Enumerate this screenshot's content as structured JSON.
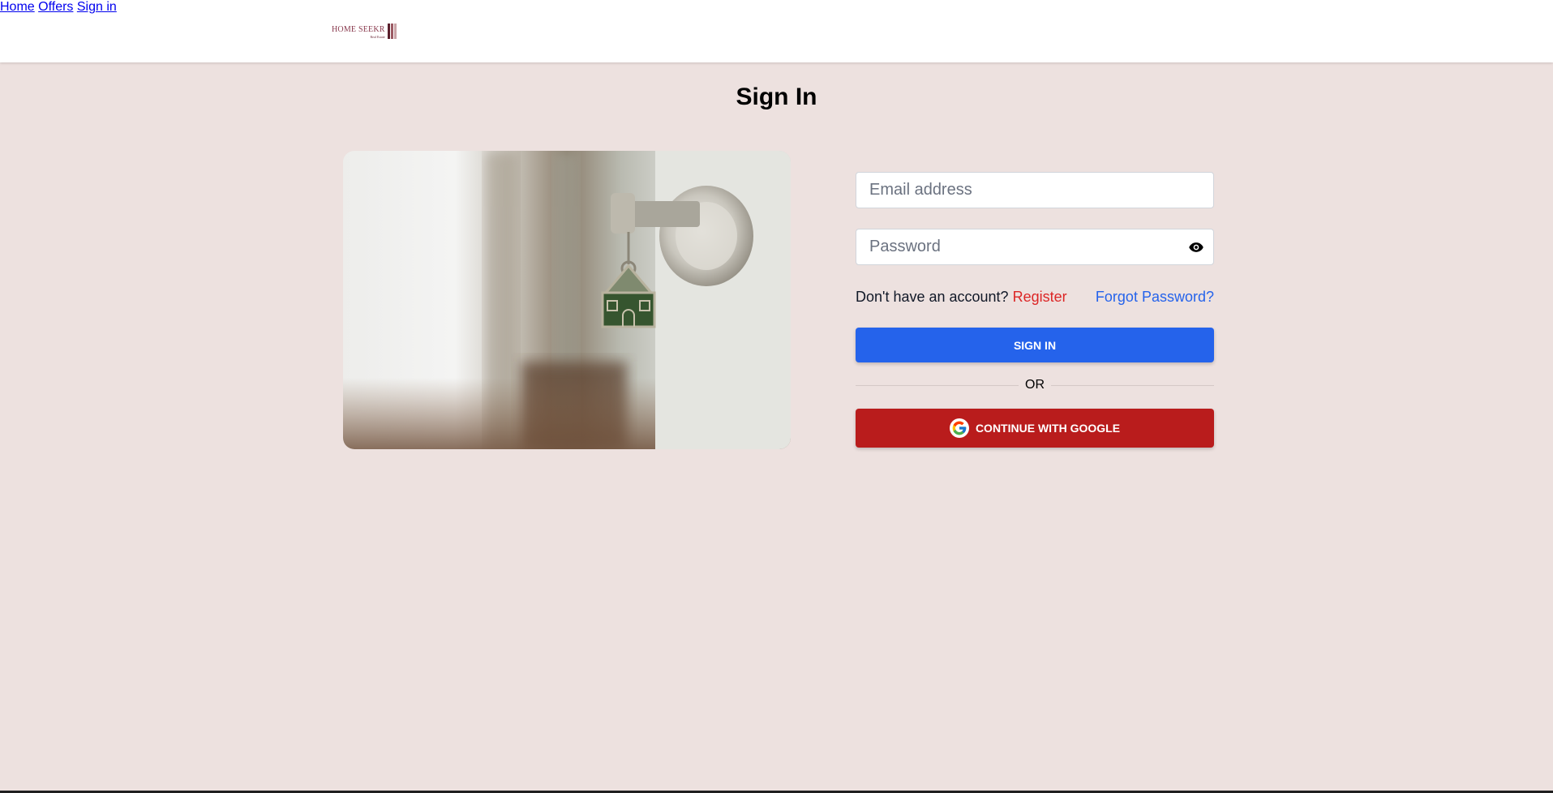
{
  "header": {
    "logo": {
      "main": "HOME SEEKR",
      "sub": "Real Estate"
    },
    "nav": [
      {
        "label": "Home"
      },
      {
        "label": "Offers"
      },
      {
        "label": "Sign in"
      }
    ]
  },
  "page": {
    "title": "Sign In"
  },
  "form": {
    "email": {
      "placeholder": "Email address",
      "value": ""
    },
    "password": {
      "placeholder": "Password",
      "value": ""
    },
    "no_account_text": "Don't have an account?",
    "register_link": "Register",
    "forgot_link": "Forgot Password?",
    "sign_in_button": "SIGN IN",
    "or_text": "OR",
    "google_button": "CONTINUE WITH GOOGLE"
  },
  "colors": {
    "page_background": "#ede1df",
    "primary_button": "#2563eb",
    "google_button": "#b91c1c",
    "register_link": "#dc2626",
    "forgot_link": "#2563eb"
  }
}
